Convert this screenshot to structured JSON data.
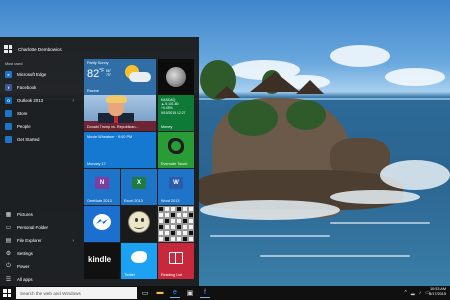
{
  "start_menu": {
    "user": "Charlotte Dembowics",
    "most_used_label": "Most used",
    "apps": [
      {
        "label": "Microsoft Edge",
        "icon": "edge-icon",
        "color": "#1e74c8",
        "glyph": "e",
        "chevron": false
      },
      {
        "label": "Facebook",
        "icon": "facebook-icon",
        "color": "#3b5998",
        "glyph": "f",
        "chevron": false
      },
      {
        "label": "Outlook 2013",
        "icon": "outlook-icon",
        "color": "#0f6abf",
        "glyph": "O",
        "chevron": true
      },
      {
        "label": "Store",
        "icon": "store-icon",
        "color": "#1e74c8",
        "glyph": "",
        "chevron": false
      },
      {
        "label": "People",
        "icon": "people-icon",
        "color": "#1e74c8",
        "glyph": "",
        "chevron": false
      },
      {
        "label": "Get Started",
        "icon": "get-started-icon",
        "color": "#1e74c8",
        "glyph": "",
        "chevron": false
      }
    ],
    "system": [
      {
        "label": "Pictures",
        "icon": "pictures-icon",
        "glyph": "▦",
        "chevron": false
      },
      {
        "label": "Personal Folder",
        "icon": "folder-icon",
        "glyph": "▭",
        "chevron": false
      },
      {
        "label": "File Explorer",
        "icon": "file-explorer-icon",
        "glyph": "▤",
        "chevron": true
      },
      {
        "label": "Settings",
        "icon": "gear-icon",
        "glyph": "⚙",
        "chevron": false
      },
      {
        "label": "Power",
        "icon": "power-icon",
        "glyph": "⏻",
        "chevron": false
      },
      {
        "label": "All apps",
        "icon": "all-apps-icon",
        "glyph": "☰",
        "chevron": false
      }
    ]
  },
  "tiles": {
    "weather": {
      "condition": "Partly Sunny",
      "temp": "82",
      "unit": "°F",
      "high": "86°",
      "low": "75°",
      "city": "Racine"
    },
    "news": {
      "headline": "Donald Trump vs. Republican..."
    },
    "money": {
      "ticker": [
        "NASDAQ",
        "▲ 5,101.80",
        "+0.45%",
        "9/19/2015 12:27"
      ],
      "name": "Money"
    },
    "calendar": {
      "event": [
        "Movie Wheatner · 9:00 PM",
        "Monday 17"
      ],
      "date": "Monday 17"
    },
    "evernote": {
      "name": "Evernote Touch"
    },
    "onenote": {
      "name": "OneNote 2013",
      "glyph": "N",
      "color": "#7a3fa0"
    },
    "excel": {
      "name": "Excel 2013",
      "glyph": "X",
      "color": "#1f7a43"
    },
    "word": {
      "name": "Word 2013",
      "glyph": "W",
      "color": "#2a5ca8"
    },
    "kindle": {
      "name": "kindle"
    },
    "twitter": {
      "name": "Twitter"
    },
    "reading": {
      "name": "Reading List"
    }
  },
  "taskbar": {
    "search_placeholder": "Search the web and Windows",
    "time": "10:53 AM",
    "date": "8/17/2015"
  }
}
